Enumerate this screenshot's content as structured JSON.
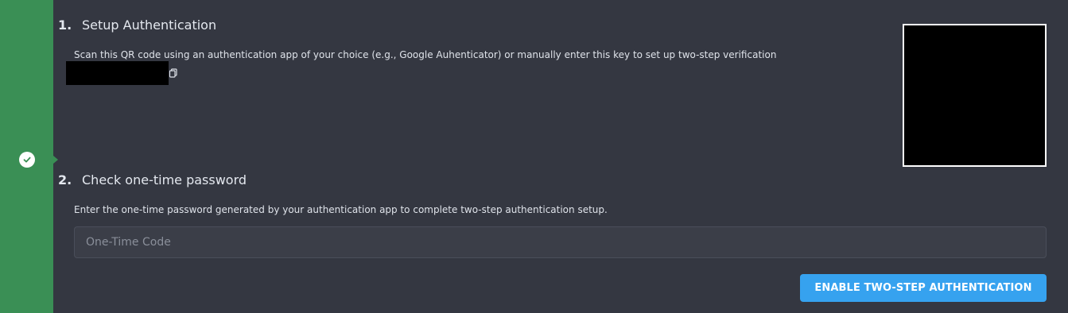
{
  "colors": {
    "background": "#343741",
    "status_bar": "#3a8f55",
    "accent_button": "#36a2ef",
    "input_background": "#3b3e48"
  },
  "status": {
    "icon": "check-circle-icon",
    "state": "complete"
  },
  "step1": {
    "number": "1.",
    "title": "Setup Authentication",
    "description": "Scan this QR code using an authentication app of your choice (e.g., Google Auhenticator) or manually enter this key to set up two-step verification",
    "copy_icon": "copy-icon",
    "secret_key_redacted": true,
    "qr_code_redacted": true
  },
  "step2": {
    "number": "2.",
    "title": "Check one-time password",
    "description": "Enter the one-time password generated by your authentication app to complete two-step authentication setup.",
    "input": {
      "value": "",
      "placeholder": "One-Time Code"
    },
    "submit_label": "ENABLE TWO-STEP AUTHENTICATION"
  }
}
